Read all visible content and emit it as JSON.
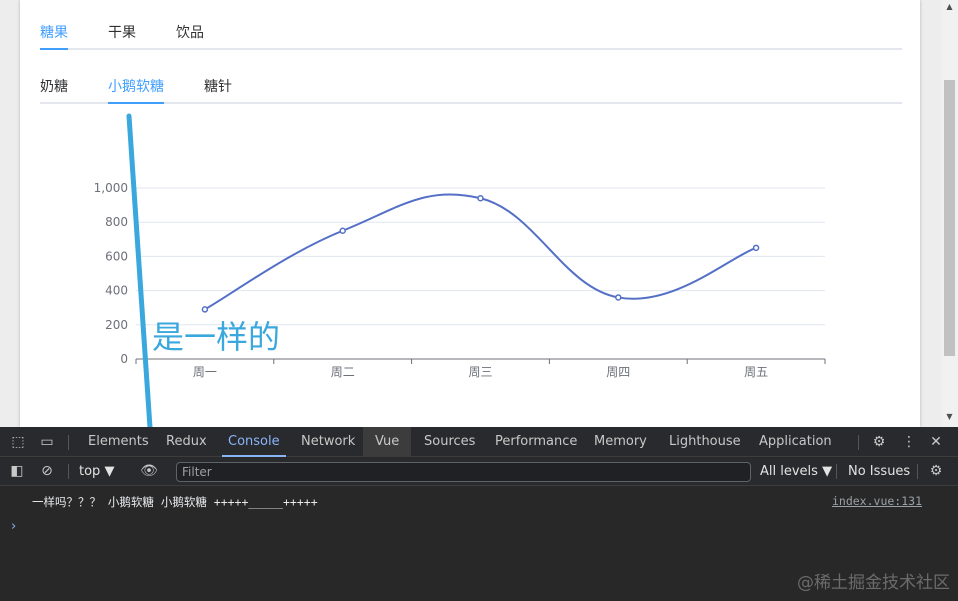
{
  "tabs_primary": [
    {
      "label": "糖果",
      "active": true
    },
    {
      "label": "干果",
      "active": false
    },
    {
      "label": "饮品",
      "active": false
    }
  ],
  "tabs_secondary": [
    {
      "label": "奶糖",
      "active": false
    },
    {
      "label": "小鹅软糖",
      "active": true
    },
    {
      "label": "糖针",
      "active": false
    }
  ],
  "chart_data": {
    "type": "line",
    "smooth": true,
    "categories": [
      "周一",
      "周二",
      "周三",
      "周四",
      "周五"
    ],
    "values": [
      290,
      750,
      940,
      360,
      650
    ],
    "ylim": [
      0,
      1000
    ],
    "yticks": [
      "0",
      "200",
      "400",
      "600",
      "800",
      "1,000"
    ],
    "color": "#5470c6",
    "grid": true
  },
  "annotation": {
    "text": "是一样的",
    "color": "#3aa7dd"
  },
  "devtools": {
    "tabs": [
      "Elements",
      "Redux",
      "Console",
      "Network",
      "Vue",
      "Sources",
      "Performance",
      "Memory",
      "Lighthouse",
      "Application"
    ],
    "active_tab": "Console",
    "toolbar": {
      "context": "top",
      "filter_placeholder": "Filter",
      "levels": "All levels",
      "issues": "No Issues"
    },
    "log": {
      "message": "一样吗？？？ 小鹅软糖 小鹅软糖 +++++_____+++++",
      "source": "index.vue:131"
    },
    "prompt": "›"
  },
  "watermark": "@稀土掘金技术社区"
}
